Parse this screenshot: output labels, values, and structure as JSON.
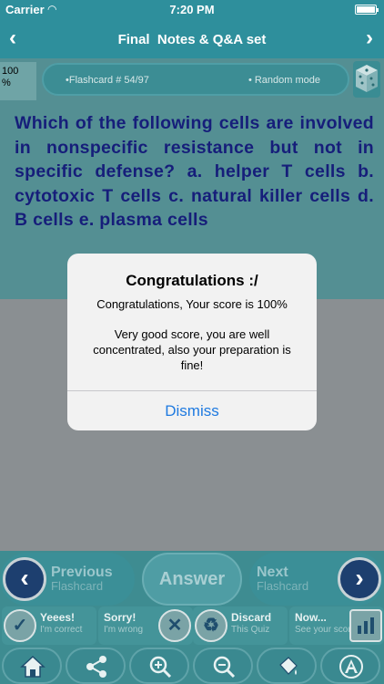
{
  "status_bar": {
    "carrier": "Carrier",
    "time": "7:20 PM"
  },
  "nav": {
    "title": "Final  Notes & Q&A set",
    "back_icon": "‹",
    "forward_icon": "›"
  },
  "score": {
    "value": "100",
    "unit": "%"
  },
  "info": {
    "card_number": "•Flashcard #  54/97",
    "mode": "• Random mode"
  },
  "question": "Which of the following cells are involved in nonspecific resistance but not in specific defense? a. helper T cells b. cytotoxic T cells c. natural killer cells d. B cells e. plasma cells",
  "alert": {
    "title": "Congratulations :/",
    "score_text": "Congratulations, Your score is 100%",
    "message": "Very good score, you are well concentrated, also your preparation is fine!",
    "dismiss_label": "Dismiss"
  },
  "toolbar": {
    "previous": {
      "line1": "Previous",
      "line2": "Flashcard"
    },
    "answer": "Answer",
    "next": {
      "line1": "Next",
      "line2": "Flashcard"
    },
    "actions": [
      {
        "title": "Yeees!",
        "sub": "I'm correct",
        "icon": "check-icon"
      },
      {
        "title": "Sorry!",
        "sub": "I'm wrong",
        "icon": "cross-icon"
      },
      {
        "title": "Discard",
        "sub": "This Quiz",
        "icon": "recycle-icon"
      },
      {
        "title": "Now...",
        "sub": "See your score",
        "icon": "bar-chart-icon"
      }
    ],
    "icons": [
      "home-icon",
      "share-icon",
      "zoom-in-icon",
      "zoom-out-icon",
      "paint-bucket-icon",
      "font-size-icon"
    ]
  },
  "colors": {
    "accent": "#2e8f9c",
    "question_text": "#161e7a",
    "dismiss": "#1f7ae0"
  }
}
